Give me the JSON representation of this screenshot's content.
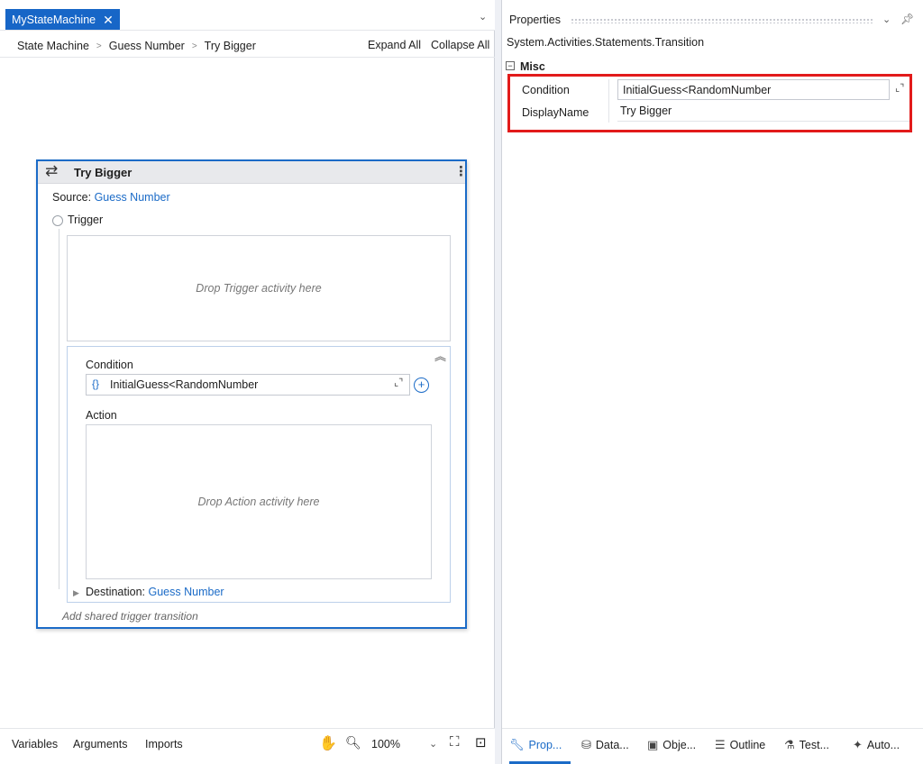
{
  "designer": {
    "tab_title": "MyStateMachine",
    "tab_close": "✕",
    "breadcrumb": [
      "State Machine",
      "Guess Number",
      "Try Bigger"
    ],
    "expand_all": "Expand All",
    "collapse_all": "Collapse All",
    "card": {
      "title": "Try Bigger",
      "source_label": "Source:",
      "source_value": "Guess Number",
      "trigger_label": "Trigger",
      "trigger_drop_hint": "Drop Trigger activity here",
      "condition_label": "Condition",
      "condition_braces": "{}",
      "condition_value": "InitialGuess<RandomNumber",
      "action_label": "Action",
      "action_drop_hint": "Drop Action activity here",
      "destination_label": "Destination:",
      "destination_value": "Guess Number",
      "add_shared": "Add shared trigger transition"
    },
    "bottom": {
      "variables": "Variables",
      "arguments": "Arguments",
      "imports": "Imports",
      "zoom": "100%"
    }
  },
  "properties": {
    "title": "Properties",
    "type_name": "System.Activities.Statements.Transition",
    "category": "Misc",
    "rows": [
      {
        "label": "Condition",
        "value": "InitialGuess<RandomNumber"
      },
      {
        "label": "DisplayName",
        "value": "Try Bigger"
      }
    ],
    "tabs": [
      "Prop...",
      "Data...",
      "Obje...",
      "Outline",
      "Test...",
      "Auto..."
    ]
  },
  "colors": {
    "accent": "#1b6bc7",
    "tab_active": "#1766c7",
    "highlight": "#e21b1b"
  },
  "icons": [
    "close-icon",
    "chevron-down-icon",
    "chevron-right-icon",
    "transition-icon",
    "more-vertical-icon",
    "collapse-up-icon",
    "expand-icon",
    "add-circle-icon",
    "hand-icon",
    "zoom-icon",
    "fit-screen-icon",
    "overview-icon",
    "pin-icon",
    "wrench-icon",
    "data-icon",
    "object-icon",
    "outline-icon",
    "test-icon",
    "auto-icon"
  ]
}
